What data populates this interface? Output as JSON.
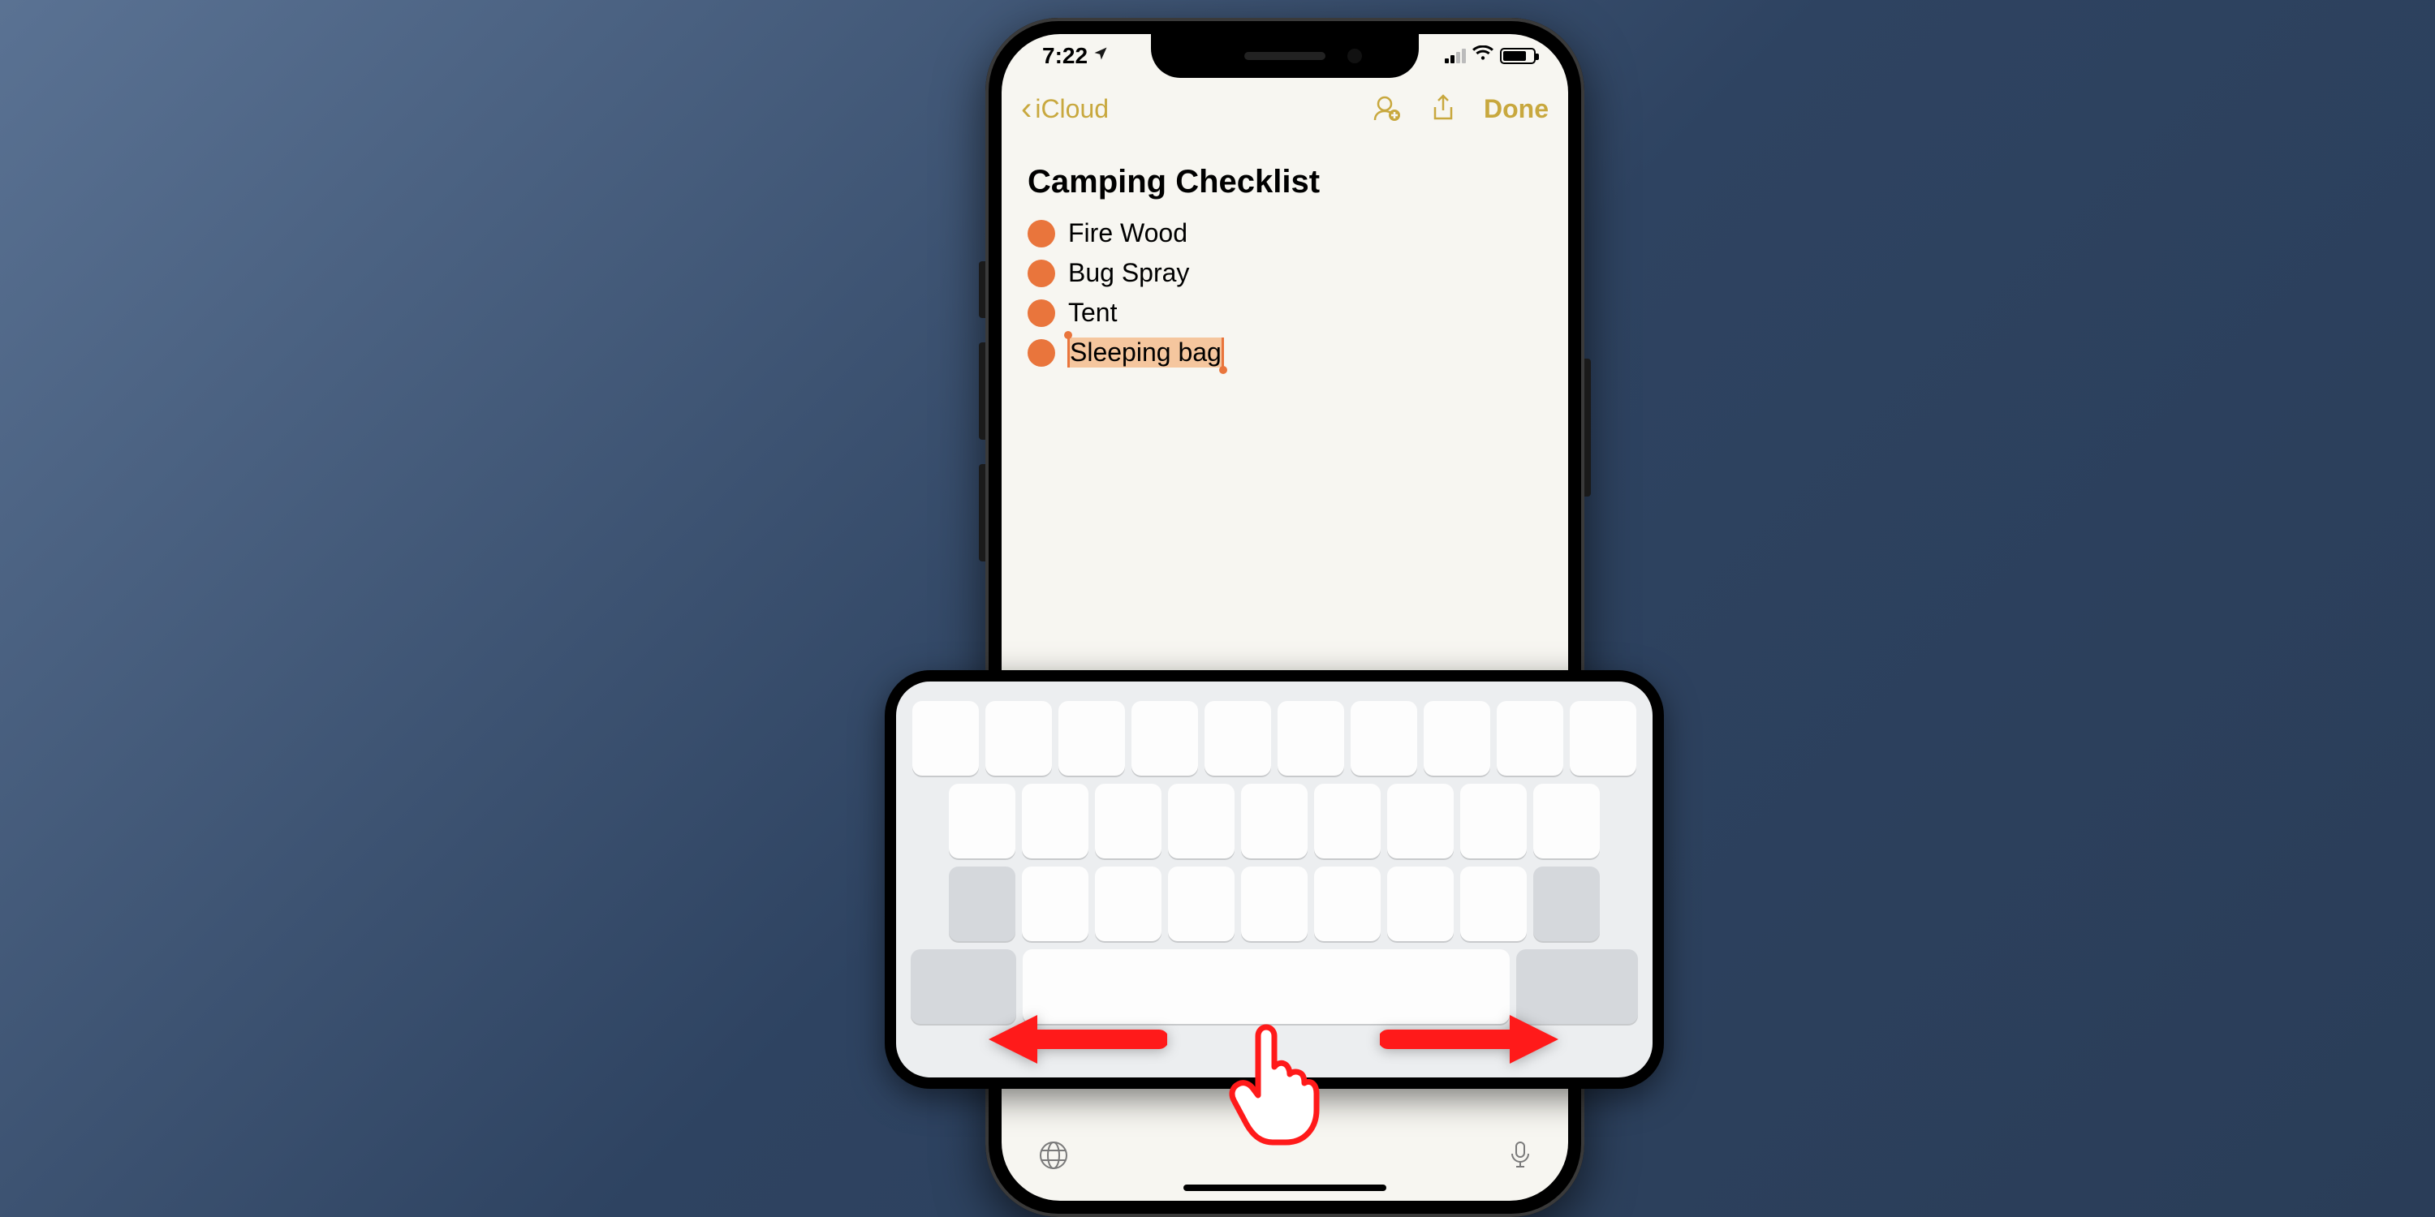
{
  "status": {
    "time": "7:22",
    "location_indicator": true
  },
  "nav": {
    "back_label": "iCloud",
    "done_label": "Done"
  },
  "note": {
    "title": "Camping Checklist",
    "items": [
      {
        "label": "Fire Wood",
        "selected": false
      },
      {
        "label": "Bug Spray",
        "selected": false
      },
      {
        "label": "Tent",
        "selected": false
      },
      {
        "label": "Sleeping bag",
        "selected": true
      }
    ]
  },
  "keyboard": {
    "mode": "trackpad-cursor",
    "gesture_hint": "drag-left-right"
  },
  "icons": {
    "location": "location-arrow-icon",
    "collaborate": "person-add-icon",
    "share": "share-icon",
    "globe": "globe-icon",
    "mic": "mic-icon"
  },
  "colors": {
    "accent": "#c8a83e",
    "bullet": "#e9753c",
    "selection": "#f5c69e",
    "arrow": "#ff1a1a"
  }
}
